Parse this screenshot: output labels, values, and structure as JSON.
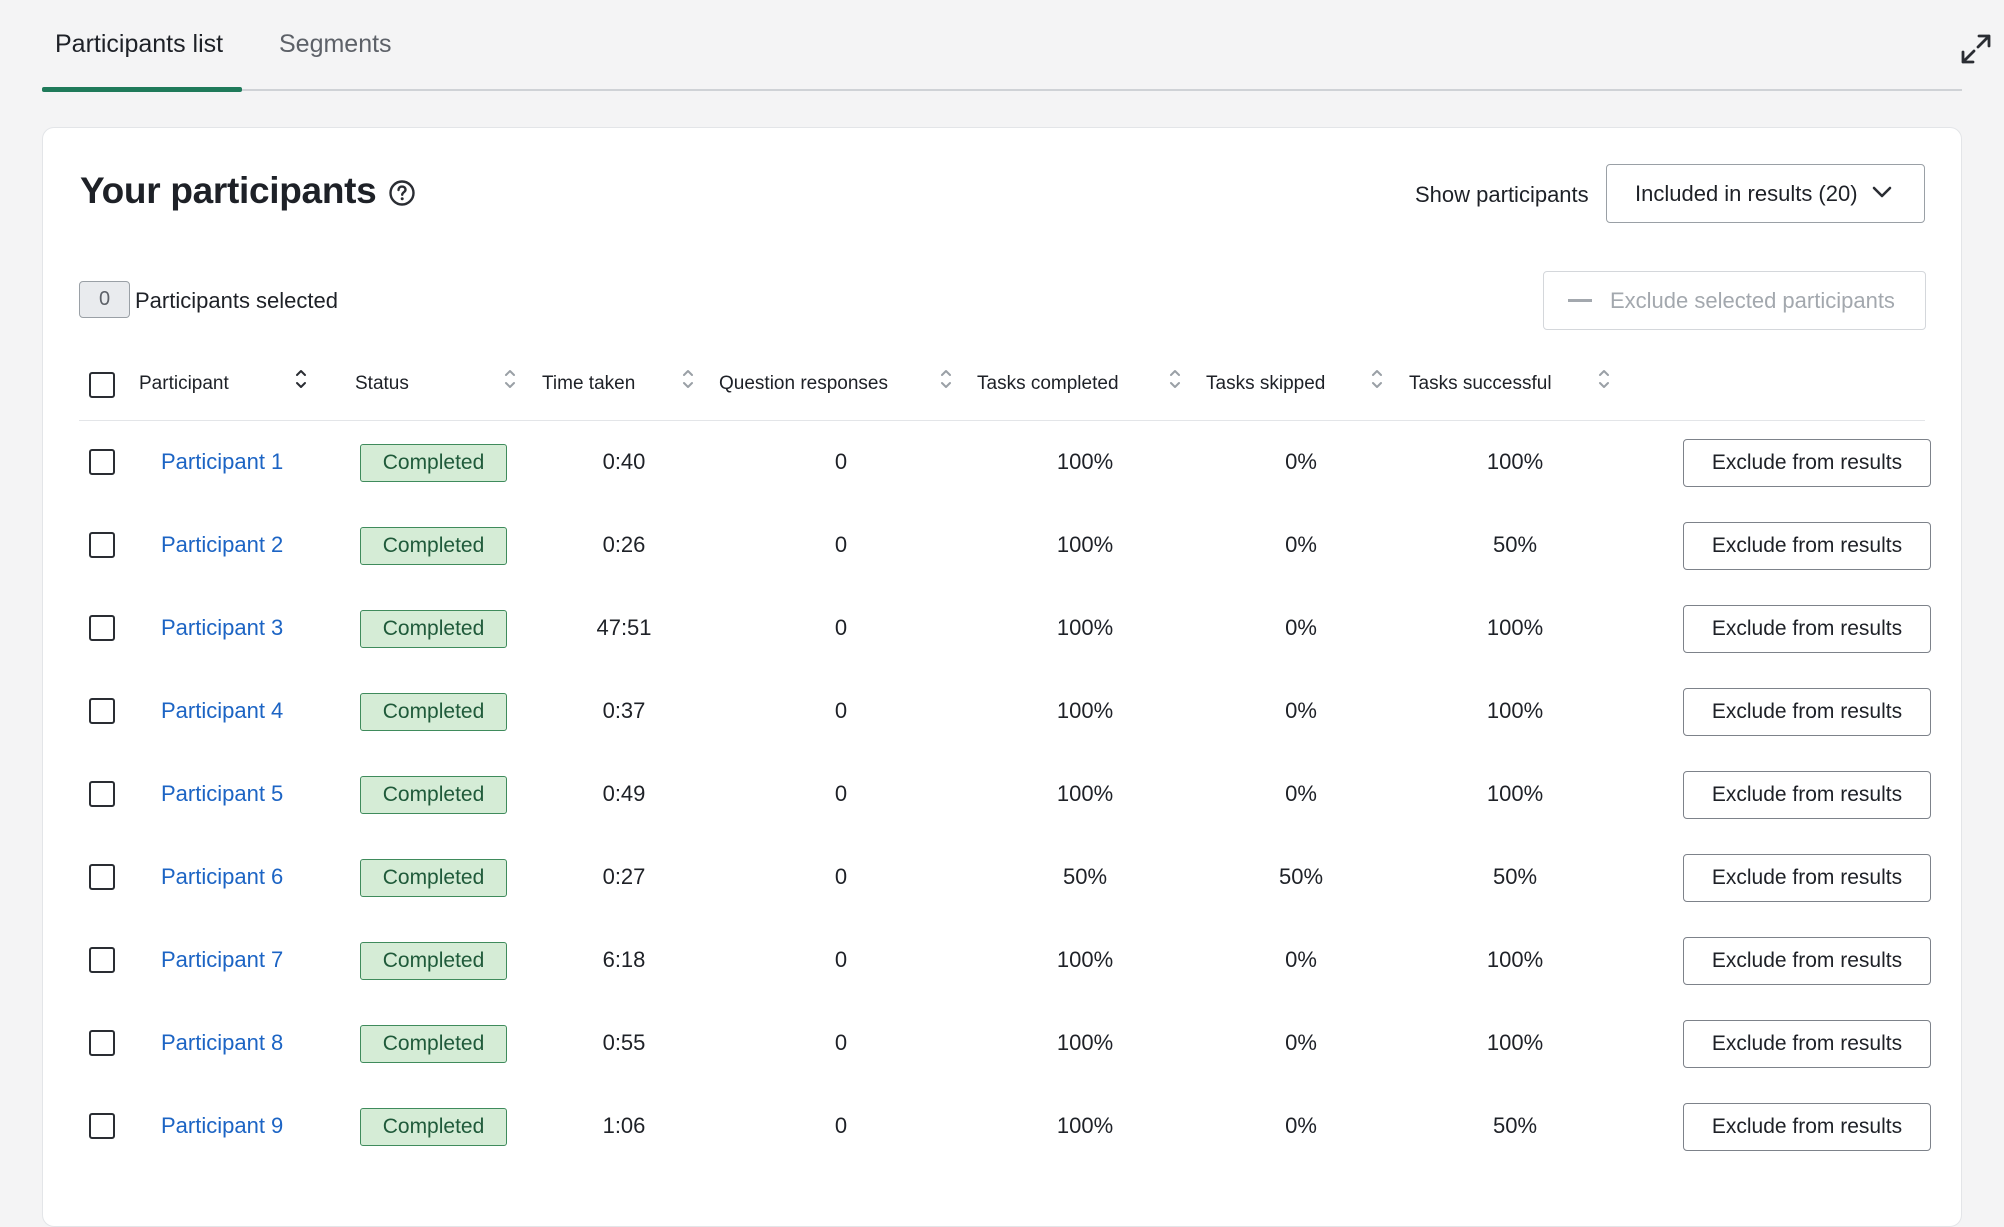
{
  "tabs": [
    {
      "label": "Participants list",
      "active": true
    },
    {
      "label": "Segments",
      "active": false
    }
  ],
  "card": {
    "title": "Your participants",
    "show_label": "Show participants",
    "dropdown_value": "Included in results (20)",
    "selected_count": "0",
    "selected_label": "Participants selected",
    "exclude_selected_label": "Exclude selected participants"
  },
  "columns": [
    "Participant",
    "Status",
    "Time taken",
    "Question responses",
    "Tasks completed",
    "Tasks skipped",
    "Tasks successful"
  ],
  "rows": [
    {
      "name": "Participant 1",
      "status": "Completed",
      "time": "0:40",
      "responses": "0",
      "completed": "100%",
      "skipped": "0%",
      "successful": "100%",
      "action": "Exclude from results"
    },
    {
      "name": "Participant 2",
      "status": "Completed",
      "time": "0:26",
      "responses": "0",
      "completed": "100%",
      "skipped": "0%",
      "successful": "50%",
      "action": "Exclude from results"
    },
    {
      "name": "Participant 3",
      "status": "Completed",
      "time": "47:51",
      "responses": "0",
      "completed": "100%",
      "skipped": "0%",
      "successful": "100%",
      "action": "Exclude from results"
    },
    {
      "name": "Participant 4",
      "status": "Completed",
      "time": "0:37",
      "responses": "0",
      "completed": "100%",
      "skipped": "0%",
      "successful": "100%",
      "action": "Exclude from results"
    },
    {
      "name": "Participant 5",
      "status": "Completed",
      "time": "0:49",
      "responses": "0",
      "completed": "100%",
      "skipped": "0%",
      "successful": "100%",
      "action": "Exclude from results"
    },
    {
      "name": "Participant 6",
      "status": "Completed",
      "time": "0:27",
      "responses": "0",
      "completed": "50%",
      "skipped": "50%",
      "successful": "50%",
      "action": "Exclude from results"
    },
    {
      "name": "Participant 7",
      "status": "Completed",
      "time": "6:18",
      "responses": "0",
      "completed": "100%",
      "skipped": "0%",
      "successful": "100%",
      "action": "Exclude from results"
    },
    {
      "name": "Participant 8",
      "status": "Completed",
      "time": "0:55",
      "responses": "0",
      "completed": "100%",
      "skipped": "0%",
      "successful": "100%",
      "action": "Exclude from results"
    },
    {
      "name": "Participant 9",
      "status": "Completed",
      "time": "1:06",
      "responses": "0",
      "completed": "100%",
      "skipped": "0%",
      "successful": "50%",
      "action": "Exclude from results"
    }
  ],
  "icons": {
    "expand": "expand-icon",
    "help": "help-circle-icon",
    "dropdown": "chevron-down-icon",
    "sort": "sort-icon"
  },
  "colors": {
    "accent": "#1f7a5a",
    "link": "#1c64c4",
    "status_bg": "#d5ecd6",
    "status_border": "#3f8b5c"
  }
}
